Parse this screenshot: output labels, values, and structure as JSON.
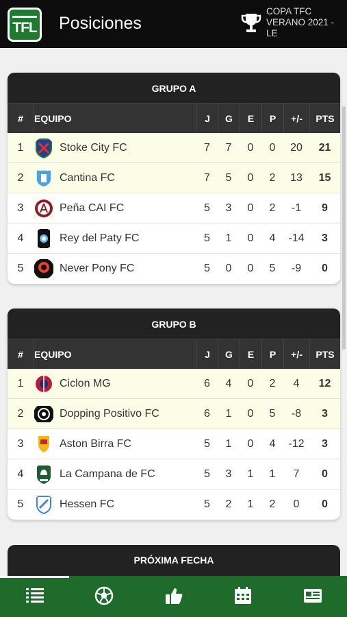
{
  "header": {
    "logo_text": "TFL",
    "title": "Posiciones",
    "tournament": "COPA TFC VERANO 2021 - LE"
  },
  "columns": {
    "pos": "#",
    "team": "EQUIPO",
    "j": "J",
    "g": "G",
    "e": "E",
    "p": "P",
    "dif": "+/-",
    "pts": "PTS"
  },
  "groups": [
    {
      "title": "GRUPO A",
      "rows": [
        {
          "pos": "1",
          "team": "Stoke City FC",
          "j": "7",
          "g": "7",
          "e": "0",
          "p": "0",
          "dif": "20",
          "pts": "21",
          "badge": "stoke-badge-icon"
        },
        {
          "pos": "2",
          "team": "Cantina FC",
          "j": "7",
          "g": "5",
          "e": "0",
          "p": "2",
          "dif": "13",
          "pts": "15",
          "badge": "cantina-badge-icon"
        },
        {
          "pos": "3",
          "team": "Peña CAI FC",
          "j": "5",
          "g": "3",
          "e": "0",
          "p": "2",
          "dif": "-1",
          "pts": "9",
          "badge": "pena-cai-badge-icon"
        },
        {
          "pos": "4",
          "team": "Rey del Paty FC",
          "j": "5",
          "g": "1",
          "e": "0",
          "p": "4",
          "dif": "-14",
          "pts": "3",
          "badge": "rey-del-paty-badge-icon"
        },
        {
          "pos": "5",
          "team": "Never Pony FC",
          "j": "5",
          "g": "0",
          "e": "0",
          "p": "5",
          "dif": "-9",
          "pts": "0",
          "badge": "never-pony-badge-icon"
        }
      ]
    },
    {
      "title": "GRUPO B",
      "rows": [
        {
          "pos": "1",
          "team": "Ciclon MG",
          "j": "6",
          "g": "4",
          "e": "0",
          "p": "2",
          "dif": "4",
          "pts": "12",
          "badge": "ciclon-badge-icon"
        },
        {
          "pos": "2",
          "team": "Dopping Positivo FC",
          "j": "6",
          "g": "1",
          "e": "0",
          "p": "5",
          "dif": "-8",
          "pts": "3",
          "badge": "dopping-badge-icon"
        },
        {
          "pos": "3",
          "team": "Aston Birra FC",
          "j": "5",
          "g": "1",
          "e": "0",
          "p": "4",
          "dif": "-12",
          "pts": "3",
          "badge": "aston-birra-badge-icon"
        },
        {
          "pos": "4",
          "team": "La Campana de FC",
          "j": "5",
          "g": "3",
          "e": "1",
          "p": "1",
          "dif": "7",
          "pts": "0",
          "badge": "la-campana-badge-icon"
        },
        {
          "pos": "5",
          "team": "Hessen FC",
          "j": "5",
          "g": "2",
          "e": "1",
          "p": "2",
          "dif": "0",
          "pts": "0",
          "badge": "hessen-badge-icon"
        }
      ]
    }
  ],
  "next_card": {
    "title": "PRÓXIMA FECHA"
  },
  "nav": [
    {
      "icon": "standings-list-icon",
      "active": true
    },
    {
      "icon": "soccer-ball-icon",
      "active": false
    },
    {
      "icon": "thumbs-up-icon",
      "active": false
    },
    {
      "icon": "calendar-icon",
      "active": false
    },
    {
      "icon": "news-icon",
      "active": false
    }
  ],
  "colors": {
    "topbar": "#0d0d0d",
    "card_header": "#222222",
    "table_header": "#333333",
    "highlight_row": "#fbfde7",
    "nav_bg": "#1e6b2c",
    "logo_green": "#1e7a2f"
  }
}
